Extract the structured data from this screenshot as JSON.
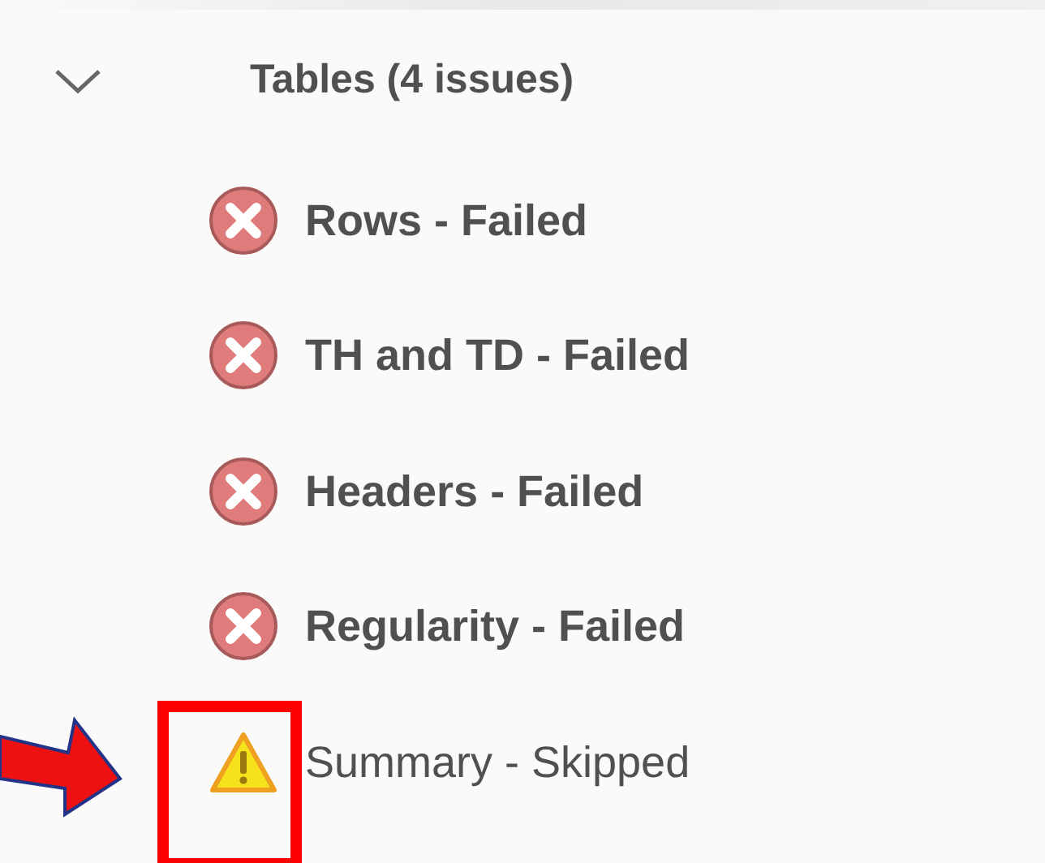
{
  "section": {
    "title": "Tables (4 issues)",
    "expanded": true,
    "items": [
      {
        "label": "Rows - Failed",
        "kind": "failed",
        "highlighted": false
      },
      {
        "label": "TH and TD - Failed",
        "kind": "failed",
        "highlighted": false
      },
      {
        "label": "Headers - Failed",
        "kind": "failed",
        "highlighted": false
      },
      {
        "label": "Regularity - Failed",
        "kind": "failed",
        "highlighted": false
      },
      {
        "label": "Summary - Skipped",
        "kind": "skipped",
        "highlighted": true
      }
    ]
  }
}
